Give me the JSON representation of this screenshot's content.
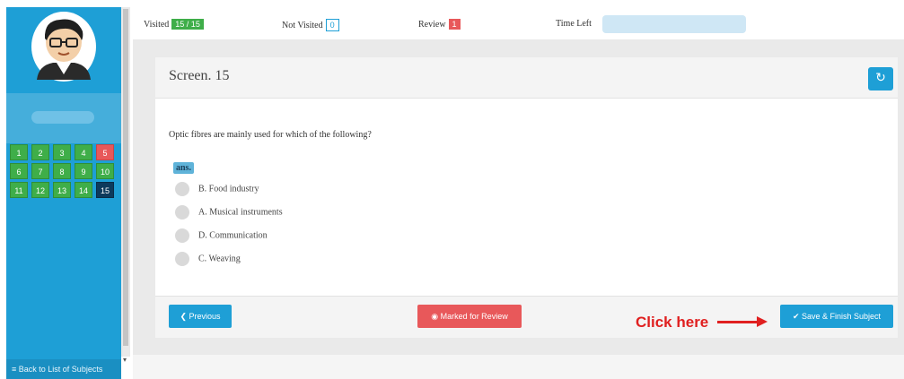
{
  "status": {
    "visited_label": "Visited",
    "visited_value": "15 / 15",
    "not_visited_label": "Not Visited",
    "not_visited_value": "0",
    "review_label": "Review",
    "review_value": "1",
    "time_left_label": "Time Left"
  },
  "sidebar": {
    "questions": [
      "1",
      "2",
      "3",
      "4",
      "5",
      "6",
      "7",
      "8",
      "9",
      "10",
      "11",
      "12",
      "13",
      "14",
      "15"
    ],
    "review_question": "5",
    "current_question": "15",
    "back_link": "Back to List of Subjects"
  },
  "screen": {
    "title": "Screen. 15",
    "question": "Optic fibres are mainly used for which of the following?",
    "ans_tag": "ans.",
    "options": [
      "B. Food industry",
      "A. Musical instruments",
      "D. Communication",
      "C. Weaving"
    ]
  },
  "buttons": {
    "previous": "Previous",
    "mark_review": "Marked for Review",
    "save_finish": "Save & Finish Subject"
  },
  "annotation": {
    "text": "Click here"
  },
  "colors": {
    "primary": "#1e9fd6",
    "success": "#3fae49",
    "danger": "#e8585a",
    "current": "#0d3a5c",
    "annotation": "#e02020"
  }
}
